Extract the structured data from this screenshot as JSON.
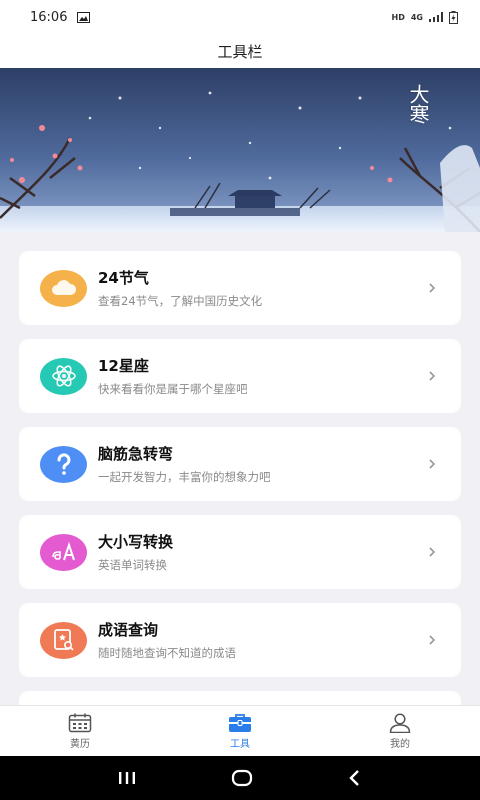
{
  "status": {
    "time": "16:06",
    "hd": "HD",
    "network": "4G"
  },
  "header": {
    "title": "工具栏"
  },
  "banner": {
    "text": "大寒"
  },
  "tools": [
    {
      "name": "24节气",
      "desc": "查看24节气，了解中国历史文化",
      "icon": "cloud-icon",
      "color": "#f5b24a"
    },
    {
      "name": "12星座",
      "desc": "快来看看你是属于哪个星座吧",
      "icon": "atom-icon",
      "color": "#25c9b4"
    },
    {
      "name": "脑筋急转弯",
      "desc": "一起开发智力，丰富你的想象力吧",
      "icon": "question-icon",
      "color": "#4f8ff5"
    },
    {
      "name": "大小写转换",
      "desc": "英语单词转换",
      "icon": "translate-icon",
      "color": "#e45bd1"
    },
    {
      "name": "成语查询",
      "desc": "随时随地查询不知道的成语",
      "icon": "book-search-icon",
      "color": "#f07a55"
    }
  ],
  "tabbar": {
    "items": [
      {
        "label": "黄历",
        "icon": "calendar-icon"
      },
      {
        "label": "工具",
        "icon": "toolbox-icon"
      },
      {
        "label": "我的",
        "icon": "user-icon"
      }
    ],
    "active_color": "#2b7de9"
  }
}
